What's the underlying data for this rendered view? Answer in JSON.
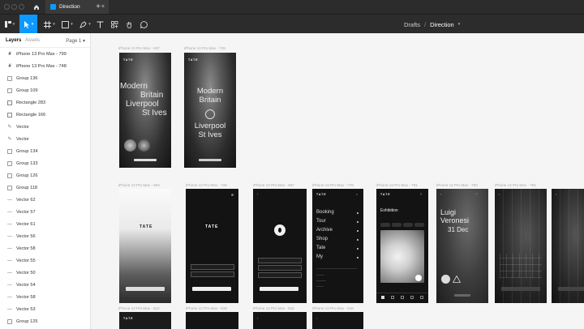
{
  "titlebar": {
    "file_tab_label": "Direction",
    "close_glyph": "×",
    "new_tab_glyph": "+"
  },
  "toolbar": {
    "breadcrumb_project": "Drafts",
    "breadcrumb_separator": "/",
    "breadcrumb_file": "Direction",
    "tools": [
      "main-menu-icon",
      "move-icon",
      "frame-icon",
      "shape-icon",
      "pen-icon",
      "text-icon",
      "resources-icon",
      "hand-icon",
      "comment-icon"
    ],
    "accent": "#0d99ff"
  },
  "panel": {
    "tab_layers": "Layers",
    "tab_assets": "Assets",
    "page_selector": "Page 1",
    "layers": [
      {
        "icon": "frame",
        "label": "iPhone 13 Pro Max - 799"
      },
      {
        "icon": "frame",
        "label": "iPhone 13 Pro Max - 748"
      },
      {
        "icon": "group",
        "label": "Group 136"
      },
      {
        "icon": "group",
        "label": "Group 109"
      },
      {
        "icon": "rect",
        "label": "Rectangle 283"
      },
      {
        "icon": "rect",
        "label": "Rectangle 166"
      },
      {
        "icon": "vector",
        "label": "Vector"
      },
      {
        "icon": "vector",
        "label": "Vector"
      },
      {
        "icon": "group",
        "label": "Group 134"
      },
      {
        "icon": "group",
        "label": "Group 133"
      },
      {
        "icon": "group",
        "label": "Group 126"
      },
      {
        "icon": "group",
        "label": "Group 118"
      },
      {
        "icon": "line",
        "label": "Vector 62"
      },
      {
        "icon": "line",
        "label": "Vector 57"
      },
      {
        "icon": "line",
        "label": "Vector 61"
      },
      {
        "icon": "line",
        "label": "Vector 56"
      },
      {
        "icon": "line",
        "label": "Vector 58"
      },
      {
        "icon": "line",
        "label": "Vector 55"
      },
      {
        "icon": "line",
        "label": "Vector 50"
      },
      {
        "icon": "line",
        "label": "Vector 54"
      },
      {
        "icon": "line",
        "label": "Vector 58"
      },
      {
        "icon": "line",
        "label": "Vector 53"
      },
      {
        "icon": "group",
        "label": "Group 125"
      }
    ]
  },
  "canvas": {
    "row1_labels": [
      "iPhone 13 Pro Max - 637",
      "iPhone 13 Pro Max - 728"
    ],
    "row2_labels": [
      "iPhone 13 Pro Max - 694",
      "iPhone 13 Pro Max - 726",
      "iPhone 13 Pro Max - 687",
      "iPhone 13 Pro Max - 778",
      "iPhone 13 Pro Max - 791",
      "iPhone 13 Pro Max - 783",
      "iPhone 13 Pro Max - 782"
    ],
    "row3_labels": [
      "iPhone 13 Pro Max - 822",
      "iPhone 13 Pro Max - 818",
      "iPhone 13 Pro Max - 815",
      "iPhone 13 Pro Max - 816"
    ],
    "hero_title_lines": [
      "Modern",
      "Britain",
      "Liverpool",
      "St Ives"
    ],
    "hero2_lines": [
      "Modern",
      "Britain",
      "Liverpool",
      "St Ives"
    ],
    "logo": "TATE",
    "menu_items": [
      "Booking",
      "Tour",
      "Archive",
      "Shop",
      "Tate",
      "My"
    ],
    "exhibition_label": "Exhibition",
    "artist_name_lines": [
      "Luigi",
      "Veronesi"
    ],
    "artist_date": "31 Dec"
  }
}
